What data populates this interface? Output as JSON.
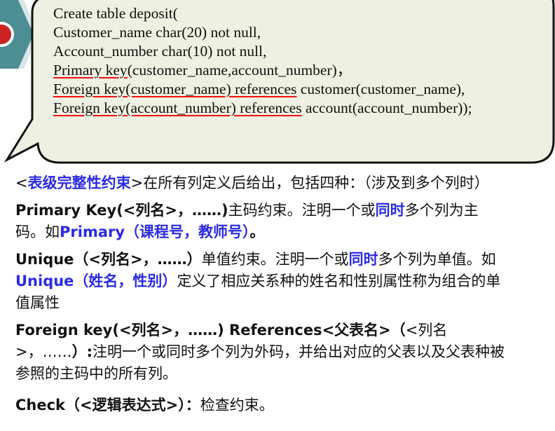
{
  "code": {
    "line1": "Create table deposit(",
    "line2": "Customer_name char(20) not null,",
    "line3": "Account_number char(10) not null,",
    "line4_key": "Primary key",
    "line4_rest": "(customer_name,account_number)，",
    "line5_key": "Foreign key(customer_name) references",
    "line5_rest": " customer(customer_name),",
    "line6_key": "Foreign key(account_number) references",
    "line6_rest": " account(account_number));"
  },
  "p1": {
    "lt": "<",
    "term": "表级完整性约束",
    "rest": ">在所有列定义后给出，包括四种：（涉及到多个列时）"
  },
  "p2": {
    "kw": "Primary  Key(<列名>，……)",
    "text1": "主码约束。注明一个或",
    "hl": "同时",
    "text2": "多个列为主码。如",
    "example": "Primary（课程号，教师号）",
    "end": "。"
  },
  "p3": {
    "kw": "Unique（<列名>，……）",
    "text1": "单值约束。注明一个或",
    "hl": "同时",
    "text2": "多个列为单值。如",
    "example": "Unique（姓名，性别）",
    "text3": "定义了相应关系种的姓名和性别属性称为组合的单值属性"
  },
  "p4": {
    "kw": "Foreign  key(<列名>，……)  References<父表名>（",
    "arg": "<列名>，……",
    "close": "）:",
    "text": "注明一个或同时多个列为外码，并给出对应的父表以及父表种被参照的主码中的所有列。"
  },
  "p5": {
    "kw": "Check（<逻辑表达式>）：",
    "text": "检查约束。"
  },
  "colors": {
    "bubble_fill": "#eef0e1",
    "highlight": "#2a2ae6",
    "underline": "#ee1111",
    "icon_band": "#4d8e94",
    "icon_red": "#cc2222"
  }
}
